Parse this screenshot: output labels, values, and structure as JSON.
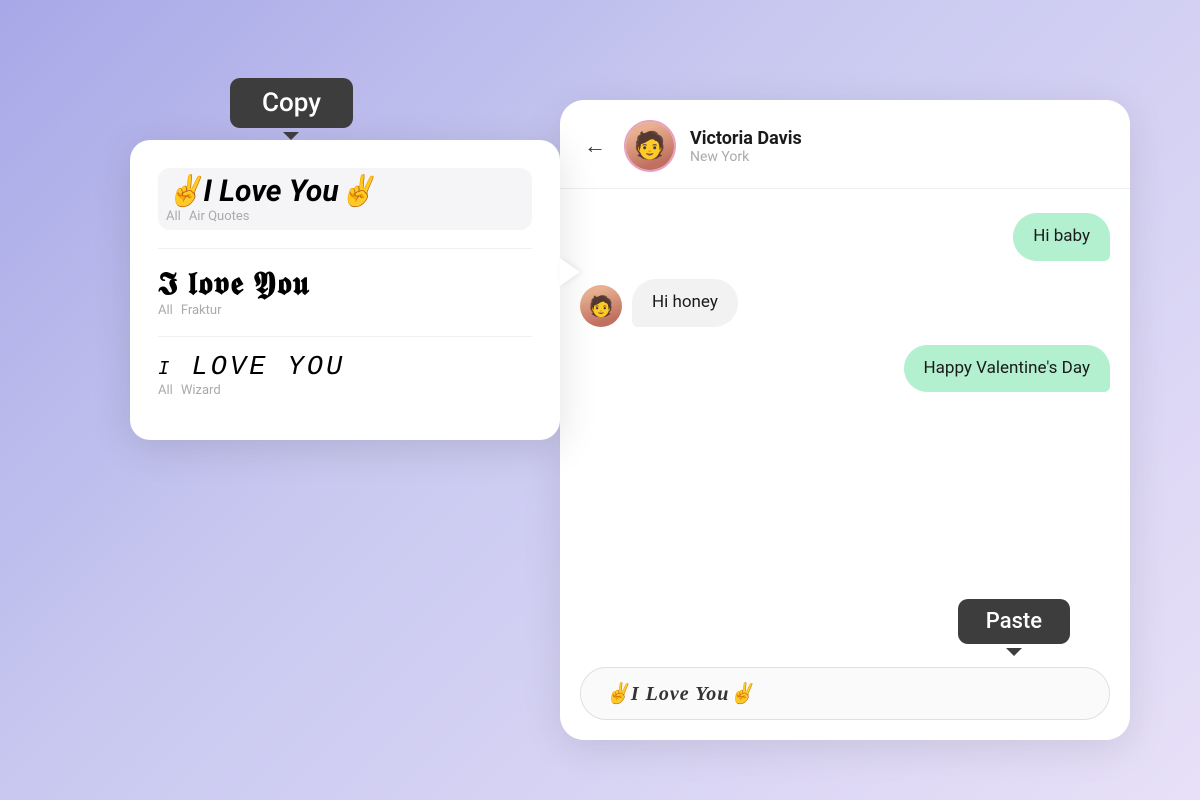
{
  "background": "#b8b8e8",
  "fontPicker": {
    "tooltip": {
      "copy": "Copy"
    },
    "items": [
      {
        "id": "air-quotes",
        "text": "✌️I Love You✌️",
        "tags": [
          "All",
          "Air Quotes"
        ],
        "style": "air-quotes",
        "highlighted": true
      },
      {
        "id": "fraktur",
        "text": "I Love You",
        "tags": [
          "All",
          "Fraktur"
        ],
        "style": "fraktur",
        "highlighted": false
      },
      {
        "id": "wizard",
        "text": "i LOVE YOU",
        "tags": [
          "All",
          "Wizard"
        ],
        "style": "wizard",
        "highlighted": false
      }
    ]
  },
  "chat": {
    "header": {
      "backLabel": "←",
      "name": "Victoria Davis",
      "location": "New York"
    },
    "messages": [
      {
        "id": "msg1",
        "type": "sent",
        "text": "Hi baby"
      },
      {
        "id": "msg2",
        "type": "received",
        "text": "Hi honey"
      },
      {
        "id": "msg3",
        "type": "sent",
        "text": "Happy Valentine's Day"
      }
    ],
    "inputValue": "✌️I Love You✌️",
    "pasteTooltip": "Paste"
  }
}
